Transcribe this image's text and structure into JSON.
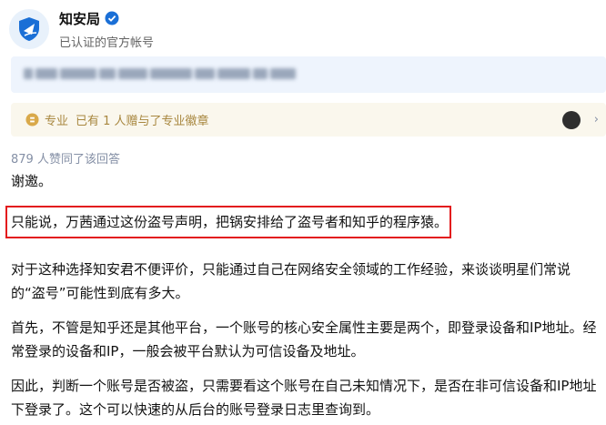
{
  "author": {
    "name": "知安局",
    "description": "已认证的官方帐号",
    "avatar_icon": "shield-logo-icon",
    "verified_icon": "verified-badge-icon",
    "brand_color": "#1a6fd6"
  },
  "badge_bar": {
    "icon": "professional-badge-icon",
    "label": "专业",
    "text": "已有 1 人赠与了专业徽章",
    "chevron": "›"
  },
  "answer": {
    "vote_text": "879 人赞同了该回答",
    "paragraphs": [
      "谢邀。",
      "只能说，万茜通过这份盗号声明，把锅安排给了盗号者和知乎的程序猿。",
      "对于这种选择知安君不便评价，只能通过自己在网络安全领域的工作经验，来谈谈明星们常说的“盗号”可能性到底有多大。",
      "首先，不管是知乎还是其他平台，一个账号的核心安全属性主要是两个，即登录设备和IP地址。经常登录的设备和IP，一般会被平台默认为可信设备及地址。",
      "因此，判断一个账号是否被盗，只需要看这个账号在自己未知情况下，是否在非可信设备和IP地址下登录了。这个可以快速的从后台的账号登录日志里查询到。"
    ],
    "highlight_color": "#e3191c"
  }
}
